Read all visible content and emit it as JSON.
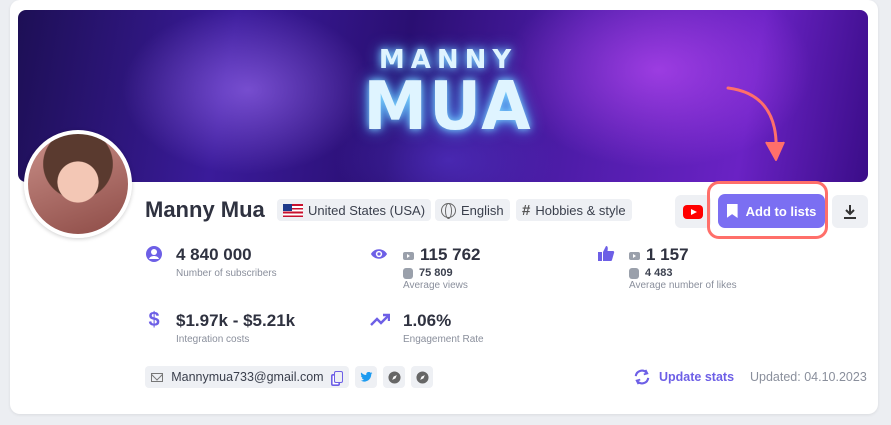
{
  "banner": {
    "line1": "MANNY",
    "line2": "MUA"
  },
  "profile": {
    "name": "Manny Mua",
    "country": "United States (USA)",
    "language": "English",
    "category": "Hobbies & style"
  },
  "actions": {
    "add_to_lists": "Add to lists"
  },
  "stats": {
    "subscribers": {
      "value": "4 840 000",
      "label": "Number of subscribers"
    },
    "views": {
      "video": "115 762",
      "shorts": "75 809",
      "label": "Average views"
    },
    "likes": {
      "video": "1 157",
      "shorts": "4 483",
      "label": "Average number of likes"
    },
    "cost": {
      "value": "$1.97k - $5.21k",
      "label": "Integration costs"
    },
    "engagement": {
      "value": "1.06%",
      "label": "Engagement Rate"
    }
  },
  "contacts": {
    "email": "Mannymua733@gmail.com"
  },
  "footer": {
    "update_label": "Update stats",
    "updated_text": "Updated: 04.10.2023"
  },
  "colors": {
    "accent": "#7b6ff2",
    "highlight": "#ff6f6a",
    "youtube": "#ff0000"
  }
}
